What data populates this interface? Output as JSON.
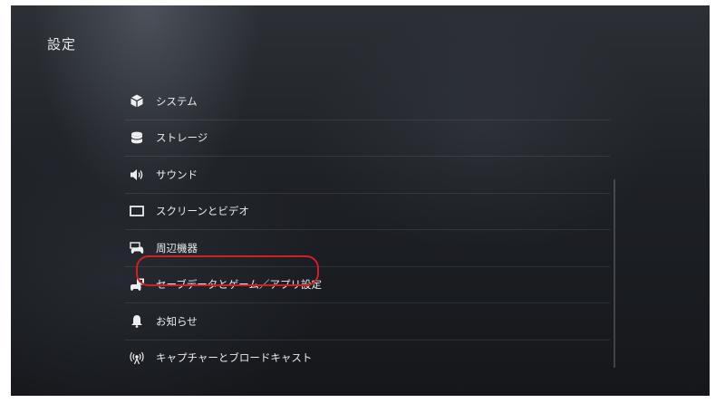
{
  "page": {
    "title": "設定"
  },
  "menu": {
    "items": [
      {
        "label": "システム",
        "icon": "system-cube-icon"
      },
      {
        "label": "ストレージ",
        "icon": "storage-icon"
      },
      {
        "label": "サウンド",
        "icon": "speaker-icon"
      },
      {
        "label": "スクリーンとビデオ",
        "icon": "screen-icon"
      },
      {
        "label": "周辺機器",
        "icon": "accessories-controller-icon"
      },
      {
        "label": "セーブデータとゲーム／アプリ設定",
        "icon": "saved-data-icon"
      },
      {
        "label": "お知らせ",
        "icon": "bell-icon"
      },
      {
        "label": "キャプチャーとブロードキャスト",
        "icon": "broadcast-icon"
      }
    ]
  },
  "annotation": {
    "highlight_color": "#d21f24",
    "highlighted_item": "セーブデータとゲーム／アプリ設定"
  }
}
